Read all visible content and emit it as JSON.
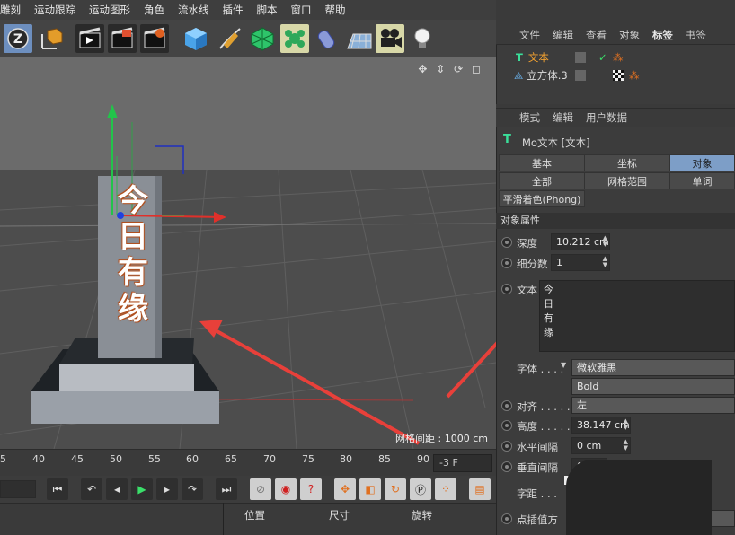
{
  "menubar": {
    "items": [
      "雕刻",
      "运动跟踪",
      "运动图形",
      "角色",
      "流水线",
      "插件",
      "脚本",
      "窗口",
      "帮助"
    ]
  },
  "toolbar": {
    "icons": [
      "z-axis-icon",
      "coordinate-system-icon",
      "render-view-icon",
      "render-picture-viewer-icon",
      "edit-render-settings-icon",
      "cube-icon",
      "pen-icon",
      "subdivision-icon",
      "mograph-cloner-icon",
      "deformer-icon",
      "floor-icon",
      "camera-icon",
      "light-icon"
    ],
    "z_label": "Z"
  },
  "viewport": {
    "grid_spacing_label": "网格间距 : 1000 cm",
    "object_text": [
      "今",
      "日",
      "有",
      "缘"
    ],
    "nav_icons": "✥ ⇕ ⟳ ◻"
  },
  "timeline": {
    "ticks": [
      "5",
      "40",
      "45",
      "50",
      "55",
      "60",
      "65",
      "70",
      "75",
      "80",
      "85",
      "90"
    ],
    "frame_value": "-3 F"
  },
  "transport": {
    "buttons": [
      "go-start",
      "prev-key",
      "prev-frame",
      "play",
      "next-frame",
      "next-key",
      "go-end"
    ]
  },
  "bottom_panel": {
    "columns": [
      "位置",
      "尺寸",
      "旋转"
    ]
  },
  "object_manager": {
    "menu": [
      "文件",
      "编辑",
      "查看",
      "对象",
      "标签",
      "书签"
    ],
    "active_menu": "标签",
    "objects": [
      {
        "name": "文本"
      },
      {
        "name": "立方体.3"
      }
    ]
  },
  "attribute_manager": {
    "menu": [
      "模式",
      "编辑",
      "用户数据"
    ],
    "title": "Mo文本 [文本]",
    "tabs_row1": [
      "基本",
      "坐标",
      "对象"
    ],
    "tabs_row2": [
      "全部",
      "网格范围",
      "单词"
    ],
    "tabs_row3": [
      "平滑着色(Phong)"
    ],
    "active_tab": "对象",
    "section_title": "对象属性",
    "depth_label": "深度",
    "depth_value": "10.212 cm",
    "subdiv_label": "细分数",
    "subdiv_value": "1",
    "text_label": "文本",
    "text_lines": [
      "今",
      "日",
      "有",
      "缘"
    ],
    "font_label": "字体 . . . .",
    "font_value": "微软雅黑",
    "font_style": "Bold",
    "align_label": "对齐 . . . . .",
    "align_value": "左",
    "height_label": "高度 . . . . .",
    "height_value": "38.147 cm",
    "hspace_label": "水平间隔",
    "hspace_value": "0 cm",
    "vspace_label": "垂直间隔",
    "vspace_value": "0 c",
    "kerning_label": "字距 . . .",
    "point_interp_label": "点插值方"
  },
  "colors": {
    "accent": "#7d9ec7",
    "annotation_arrow": "#e8403a"
  }
}
